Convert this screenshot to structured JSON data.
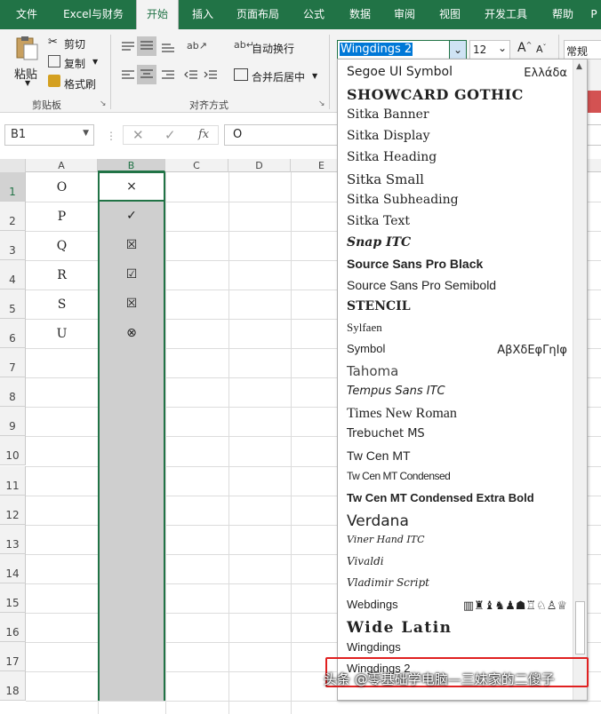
{
  "tabs": [
    "文件",
    "Excel与财务",
    "开始",
    "插入",
    "页面布局",
    "公式",
    "数据",
    "审阅",
    "视图",
    "开发工具",
    "帮助",
    "P"
  ],
  "active_tab": "开始",
  "ribbon": {
    "paste": "粘贴",
    "cut": "剪切",
    "copy": "复制",
    "format_painter": "格式刷",
    "clipboard_group": "剪贴板",
    "wrap_text": "自动换行",
    "merge_center": "合并后居中",
    "alignment_group": "对齐方式",
    "number_format": "常规"
  },
  "font_name": "Wingdings 2",
  "font_size": "12",
  "name_box": "B1",
  "formula_value": "O",
  "formula_icons": [
    "cancel-icon",
    "enter-icon",
    "fx-icon"
  ],
  "columns": [
    "A",
    "B",
    "C",
    "D",
    "E"
  ],
  "rows": [
    "1",
    "2",
    "3",
    "4",
    "5",
    "6",
    "7",
    "8",
    "9",
    "10",
    "11",
    "12",
    "13",
    "14",
    "15",
    "16",
    "17",
    "18"
  ],
  "colA": [
    "O",
    "P",
    "Q",
    "R",
    "S",
    "U"
  ],
  "colB": [
    "×",
    "✓",
    "☒",
    "☑",
    "☒",
    "⊗"
  ],
  "fonts": [
    {
      "name": "Segoe UI Symbol",
      "sample": "Ελλάδα"
    },
    {
      "name": "SHOWCARD GOTHIC",
      "sample": ""
    },
    {
      "name": "Sitka Banner",
      "sample": ""
    },
    {
      "name": "Sitka Display",
      "sample": ""
    },
    {
      "name": "Sitka Heading",
      "sample": ""
    },
    {
      "name": "Sitka Small",
      "sample": ""
    },
    {
      "name": "Sitka Subheading",
      "sample": ""
    },
    {
      "name": "Sitka Text",
      "sample": ""
    },
    {
      "name": "Snap ITC",
      "sample": ""
    },
    {
      "name": "Source Sans Pro Black",
      "sample": ""
    },
    {
      "name": "Source Sans Pro Semibold",
      "sample": ""
    },
    {
      "name": "STENCIL",
      "sample": ""
    },
    {
      "name": "Sylfaen",
      "sample": ""
    },
    {
      "name": "Symbol",
      "sample": "ΑβΧδΕφΓηΙφ"
    },
    {
      "name": "Tahoma",
      "sample": ""
    },
    {
      "name": "Tempus Sans ITC",
      "sample": ""
    },
    {
      "name": "Times New Roman",
      "sample": ""
    },
    {
      "name": "Trebuchet MS",
      "sample": ""
    },
    {
      "name": "Tw Cen MT",
      "sample": ""
    },
    {
      "name": "Tw Cen MT Condensed",
      "sample": ""
    },
    {
      "name": "Tw Cen MT Condensed Extra Bold",
      "sample": ""
    },
    {
      "name": "Verdana",
      "sample": ""
    },
    {
      "name": "Viner Hand ITC",
      "sample": ""
    },
    {
      "name": "Vivaldi",
      "sample": ""
    },
    {
      "name": "Vladimir Script",
      "sample": ""
    },
    {
      "name": "Webdings",
      "sample": "▥♜♝♞♟☗♖♘♙♕"
    },
    {
      "name": "Wide Latin",
      "sample": ""
    },
    {
      "name": "Wingdings",
      "sample": ""
    },
    {
      "name": "Wingdings 2",
      "sample": ""
    }
  ],
  "watermark": "头条 @零基础学电脑—三妹家的二傻子",
  "colors": {
    "excel_green": "#217346",
    "highlight": "#e02020",
    "selection": "#cfcfcf"
  }
}
